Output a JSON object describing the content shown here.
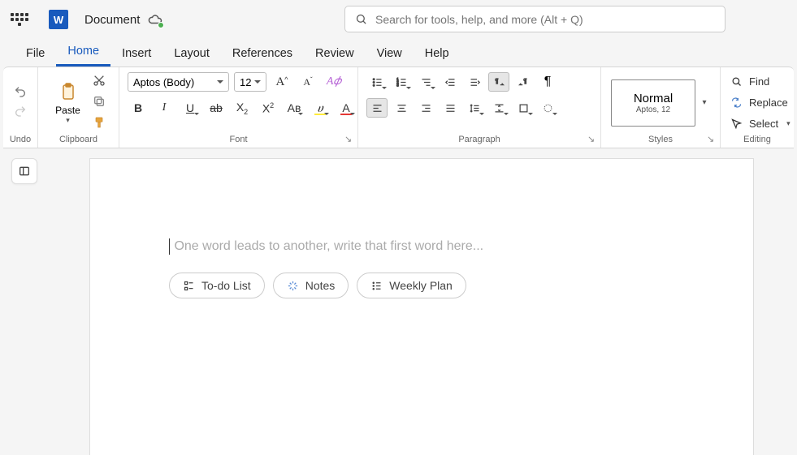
{
  "title": "Document",
  "search_placeholder": "Search for tools, help, and more (Alt + Q)",
  "tabs": {
    "t0": "File",
    "t1": "Home",
    "t2": "Insert",
    "t3": "Layout",
    "t4": "References",
    "t5": "Review",
    "t6": "View",
    "t7": "Help",
    "active": "Home"
  },
  "groups": {
    "undo": "Undo",
    "clipboard": "Clipboard",
    "font": "Font",
    "paragraph": "Paragraph",
    "styles": "Styles",
    "editing": "Editing"
  },
  "clipboard": {
    "paste": "Paste"
  },
  "font": {
    "name": "Aptos (Body)",
    "size": "12"
  },
  "styles": {
    "name": "Normal",
    "sub": "Aptos, 12"
  },
  "editing": {
    "find": "Find",
    "replace": "Replace",
    "select": "Select"
  },
  "doc": {
    "placeholder": "One word leads to another, write that first word here...",
    "chips": {
      "c0": "To-do List",
      "c1": "Notes",
      "c2": "Weekly Plan"
    }
  }
}
